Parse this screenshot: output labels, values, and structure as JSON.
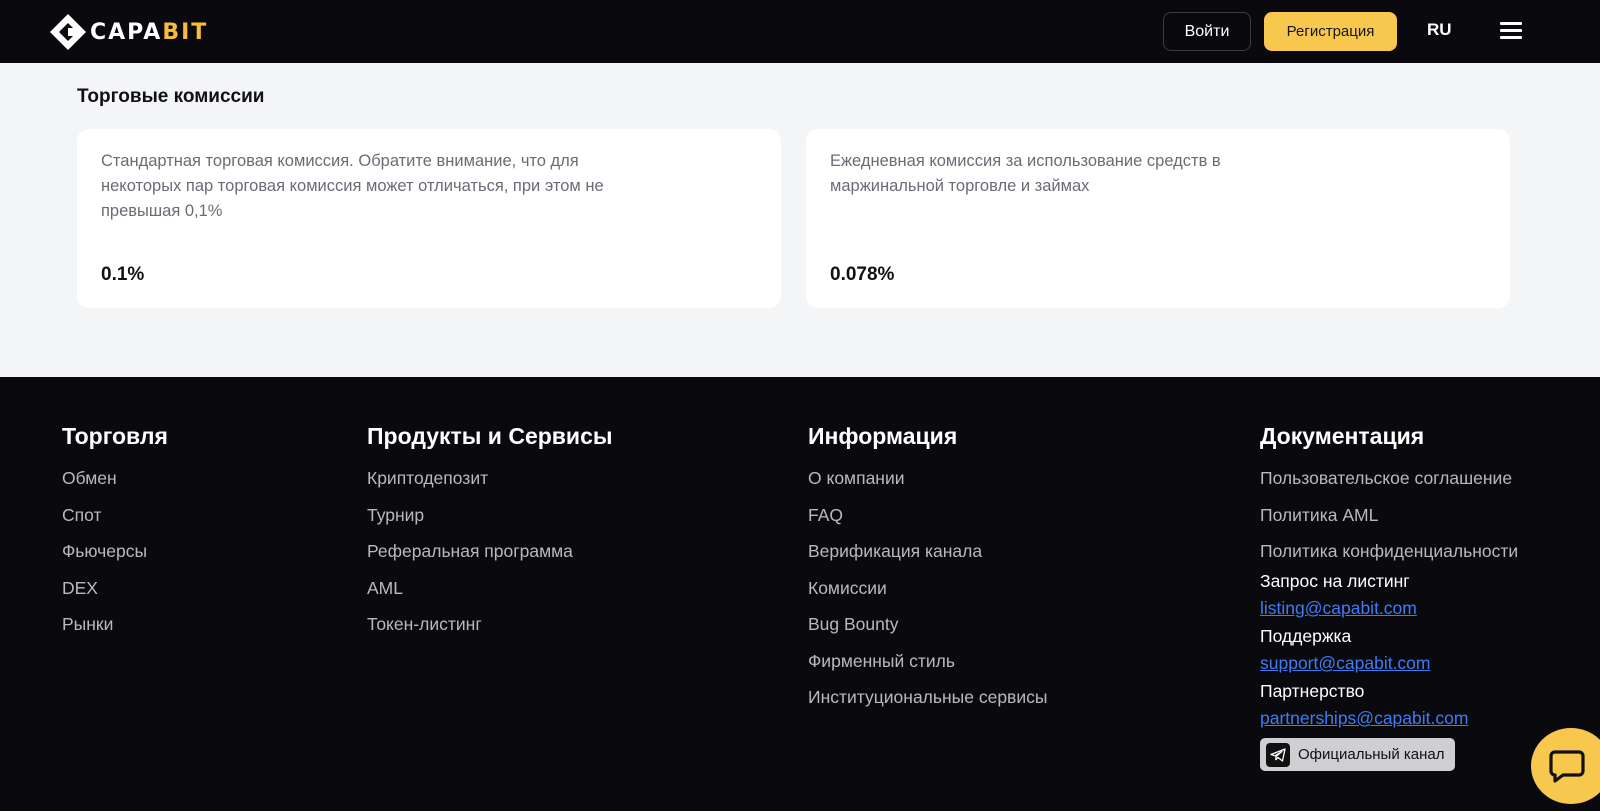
{
  "header": {
    "logo": {
      "text_main": "CAPA",
      "text_accent": "BIT"
    },
    "login_label": "Войти",
    "register_label": "Регистрация",
    "language": "RU",
    "menu_icon": "hamburger-icon"
  },
  "fees": {
    "title": "Торговые комиссии",
    "cards": [
      {
        "description": "Стандартная торговая комиссия. Обратите внимание, что для некоторых пар торговая комиссия может отличаться, при этом не превышая 0,1%",
        "value": "0.1%"
      },
      {
        "description": "Ежедневная комиссия за использование средств в маржинальной торговле и займах",
        "value": "0.078%"
      }
    ]
  },
  "footer": {
    "columns": [
      {
        "title": "Торговля",
        "links": [
          "Обмен",
          "Спот",
          "Фьючерсы",
          "DEX",
          "Рынки"
        ]
      },
      {
        "title": "Продукты и Сервисы",
        "links": [
          "Криптодепозит",
          "Турнир",
          "Реферальная программа",
          "AML",
          "Токен-листинг"
        ]
      },
      {
        "title": "Информация",
        "links": [
          "О компании",
          "FAQ",
          "Верификация канала",
          "Комиссии",
          "Bug Bounty",
          "Фирменный стиль",
          "Институциональные сервисы"
        ]
      },
      {
        "title": "Документация",
        "links": [
          "Пользовательское соглашение",
          "Политика AML",
          "Политика конфиденциальности"
        ]
      }
    ],
    "contacts": [
      {
        "label": "Запрос на листинг",
        "email": "listing@capabit.com"
      },
      {
        "label": "Поддержка",
        "email": "support@capabit.com"
      },
      {
        "label": "Партнерство",
        "email": "partnerships@capabit.com"
      }
    ],
    "telegram_label": "Официальный канал"
  },
  "colors": {
    "accent": "#f7c84d",
    "dark_bg": "#0a0a0e",
    "link_blue": "#3f7cf4"
  }
}
